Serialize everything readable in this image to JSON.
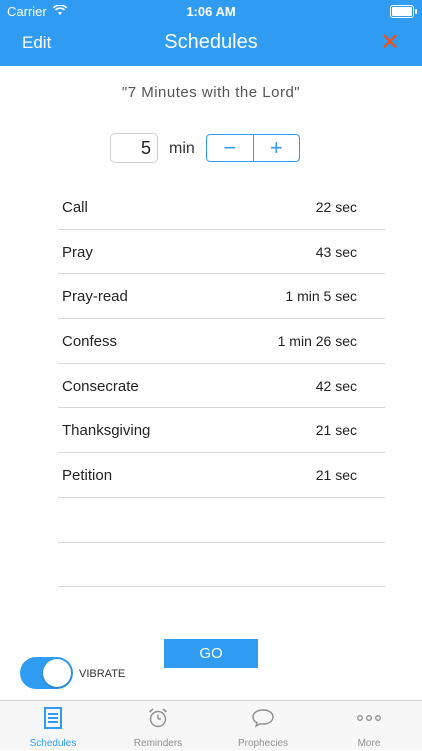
{
  "status_bar": {
    "carrier": "Carrier",
    "time": "1:06 AM"
  },
  "nav": {
    "edit_label": "Edit",
    "title": "Schedules",
    "close_icon": "✕"
  },
  "subtitle": "\"7 Minutes with the Lord\"",
  "minutes": {
    "value": "5",
    "unit": "min",
    "decrement": "−",
    "increment": "+"
  },
  "items": [
    {
      "name": "Call",
      "duration": "22 sec"
    },
    {
      "name": "Pray",
      "duration": "43 sec"
    },
    {
      "name": "Pray-read",
      "duration": "1 min 5 sec"
    },
    {
      "name": "Confess",
      "duration": "1 min 26 sec"
    },
    {
      "name": "Consecrate",
      "duration": "42 sec"
    },
    {
      "name": "Thanksgiving",
      "duration": "21 sec"
    },
    {
      "name": "Petition",
      "duration": "21 sec"
    }
  ],
  "go_label": "GO",
  "vibrate": {
    "label": "VIBRATE",
    "on": true
  },
  "tabs": [
    {
      "label": "Schedules",
      "icon": "schedules-icon",
      "active": true
    },
    {
      "label": "Reminders",
      "icon": "alarm-clock-icon",
      "active": false
    },
    {
      "label": "Prophecies",
      "icon": "speech-bubble-icon",
      "active": false
    },
    {
      "label": "More",
      "icon": "more-dots-icon",
      "active": false
    }
  ],
  "colors": {
    "accent": "#2f9cf2",
    "close": "#e9531d",
    "inactive": "#8e8e93"
  }
}
